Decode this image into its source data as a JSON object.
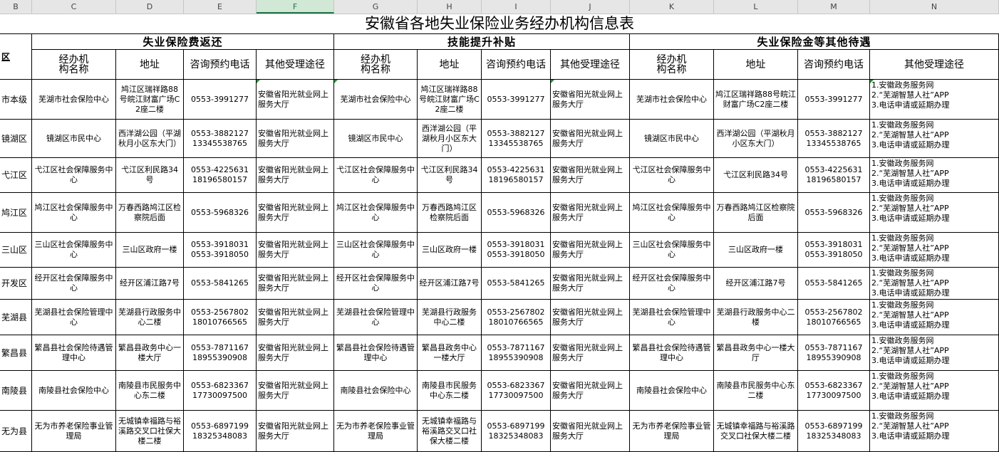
{
  "columns": [
    "B",
    "C",
    "D",
    "E",
    "F",
    "G",
    "H",
    "I",
    "J",
    "K",
    "L",
    "M",
    "N"
  ],
  "selected_column": "F",
  "title": "安徽省各地失业保险业务经办机构信息表",
  "region_header": "区",
  "groups": [
    "失业保险费返还",
    "技能提升补贴",
    "失业保险金等其他待遇"
  ],
  "subheaders": [
    "经办机\n构名称",
    "地址",
    "咨询预约电话",
    "其他受理途径"
  ],
  "rows": [
    {
      "region": "市本级",
      "g1": [
        "芜湖市社会保险中心",
        "鸠江区瑞祥路88号皖江财富广场C2座二楼",
        "0553-3991277",
        "安徽省阳光就业网上服务大厅"
      ],
      "g2": [
        "芜湖市社会保险中心",
        "鸠江区瑞祥路88号皖江财富广场C2座二楼",
        "0553-3991277",
        "安徽省阳光就业网上服务大厅"
      ],
      "g3": [
        "芜湖市社会保险中心",
        "鸠江区瑞祥路88号皖江财富广场C2座二楼",
        "0553-3991277",
        "1.安徽政务服务网\n2.“芜湖智慧人社”APP\n3.电话申请或延期办理"
      ]
    },
    {
      "region": "镜湖区",
      "g1": [
        "镜湖区市民中心",
        "西洋湖公园（平湖秋月小区东大门）",
        "0553-3882127\n13345538765",
        "安徽省阳光就业网上服务大厅"
      ],
      "g2": [
        "镜湖区市民中心",
        "西洋湖公园（平湖秋月小区东大门）",
        "0553-3882127\n13345538765",
        "安徽省阳光就业网上服务大厅"
      ],
      "g3": [
        "镜湖区市民中心",
        "西洋湖公园（平湖秋月小区东大门）",
        "0553-3882127\n13345538765",
        "1.安徽政务服务网\n2.“芜湖智慧人社”APP\n3.电话申请或延期办理"
      ]
    },
    {
      "region": "弋江区",
      "g1": [
        "弋江区社会保障服务中心",
        "弋江区利民路34号",
        "0553-4225631\n18196580157",
        "安徽省阳光就业网上服务大厅"
      ],
      "g2": [
        "弋江区社会保障服务中心",
        "弋江区利民路34号",
        "0553-4225631\n18196580157",
        "安徽省阳光就业网上服务大厅"
      ],
      "g3": [
        "弋江区社会保障服务中心",
        "弋江区利民路34号",
        "0553-4225631\n18196580157",
        "1.安徽政务服务网\n2.“芜湖智慧人社”APP\n3.电话申请或延期办理"
      ]
    },
    {
      "region": "鸠江区",
      "g1": [
        "鸠江区社会保障服务中心",
        "万春西路鸠江区检察院后面",
        "0553-5968326",
        "安徽省阳光就业网上服务大厅"
      ],
      "g2": [
        "鸠江区社会保障服务中心",
        "万春西路鸠江区检察院后面",
        "0553-5968326",
        "安徽省阳光就业网上服务大厅"
      ],
      "g3": [
        "鸠江区社会保障服务中心",
        "万春西路鸠江区检察院后面",
        "0553-5968326",
        "1.安徽政务服务网\n2.“芜湖智慧人社”APP\n3.电话申请或延期办理"
      ]
    },
    {
      "region": "三山区",
      "g1": [
        "三山区社会保障服务中心",
        "三山区政府一楼",
        "0553-3918031\n0553-3918050",
        "安徽省阳光就业网上服务大厅"
      ],
      "g2": [
        "三山区社会保障服务中心",
        "三山区政府一楼",
        "0553-3918031\n0553-3918050",
        "安徽省阳光就业网上服务大厅"
      ],
      "g3": [
        "三山区社会保障服务中心",
        "三山区政府一楼",
        "0553-3918031\n0553-3918050",
        "1.安徽政务服务网\n2.“芜湖智慧人社”APP\n3.电话申请或延期办理"
      ]
    },
    {
      "region": "开发区",
      "g1": [
        "经开区社会保障服务中心",
        "经开区浦江路7号",
        "0553-5841265",
        "安徽省阳光就业网上服务大厅"
      ],
      "g2": [
        "经开区社会保障服务中心",
        "经开区浦江路7号",
        "0553-5841265",
        "安徽省阳光就业网上服务大厅"
      ],
      "g3": [
        "经开区社会保障服务中心",
        "经开区浦江路7号",
        "0553-5841265",
        "1.安徽政务服务网\n2.“芜湖智慧人社”APP\n3.电话申请或延期办理"
      ]
    },
    {
      "region": "芜湖县",
      "g1": [
        "芜湖县社会保险管理中心",
        "芜湖县行政服务中心二楼",
        "0553-2567802\n18010766565",
        "安徽省阳光就业网上服务大厅"
      ],
      "g2": [
        "芜湖县社会保险管理中心",
        "芜湖县行政服务中心二楼",
        "0553-2567802\n18010766565",
        "安徽省阳光就业网上服务大厅"
      ],
      "g3": [
        "芜湖县社会保险管理中心",
        "芜湖县行政服务中心二楼",
        "0553-2567802\n18010766565",
        "1.安徽政务服务网\n2.“芜湖智慧人社”APP\n3.电话申请或延期办理"
      ]
    },
    {
      "region": "繁昌县",
      "g1": [
        "繁昌县社会保险待遇管理中心",
        "繁昌县政务中心一楼大厅",
        "0553-7871167\n18955390908",
        "安徽省阳光就业网上服务大厅"
      ],
      "g2": [
        "繁昌县社会保险待遇管理中心",
        "繁昌县政务中心一楼大厅",
        "0553-7871167\n18955390908",
        "安徽省阳光就业网上服务大厅"
      ],
      "g3": [
        "繁昌县社会保险待遇管理中心",
        "繁昌县政务中心一楼大厅",
        "0553-7871167\n18955390908",
        "1.安徽政务服务网\n2.“芜湖智慧人社”APP\n3.电话申请或延期办理"
      ]
    },
    {
      "region": "南陵县",
      "g1": [
        "南陵县社会保险中心",
        "南陵县市民服务中心东二楼",
        "0553-6823367\n17730097500",
        "安徽省阳光就业网上服务大厅"
      ],
      "g2": [
        "南陵县社会保险中心",
        "南陵县市民服务中心东二楼",
        "0553-6823367\n17730097500",
        "安徽省阳光就业网上服务大厅"
      ],
      "g3": [
        "南陵县社会保险中心",
        "南陵县市民服务中心东二楼",
        "0553-6823367\n17730097500",
        "1.安徽政务服务网\n2.“芜湖智慧人社”APP\n3.电话申请或延期办理"
      ]
    },
    {
      "region": "无为县",
      "g1": [
        "无为市养老保险事业管理局",
        "无城镇幸福路与裕溪路交叉口社保大楼二楼",
        "0553-6897199\n18325348083",
        "安徽省阳光就业网上服务大厅"
      ],
      "g2": [
        "无为市养老保险事业管理局",
        "无城镇幸福路与裕溪路交叉口社保大楼二楼",
        "0553-6897199\n18325348083",
        "安徽省阳光就业网上服务大厅"
      ],
      "g3": [
        "无为市养老保险事业管理局",
        "无城镇幸福路与裕溪路交叉口社保大楼二楼",
        "0553-6897199\n18325348083",
        "1.安徽政务服务网\n2.“芜湖智慧人社”APP\n3.电话申请或延期办理"
      ]
    }
  ]
}
